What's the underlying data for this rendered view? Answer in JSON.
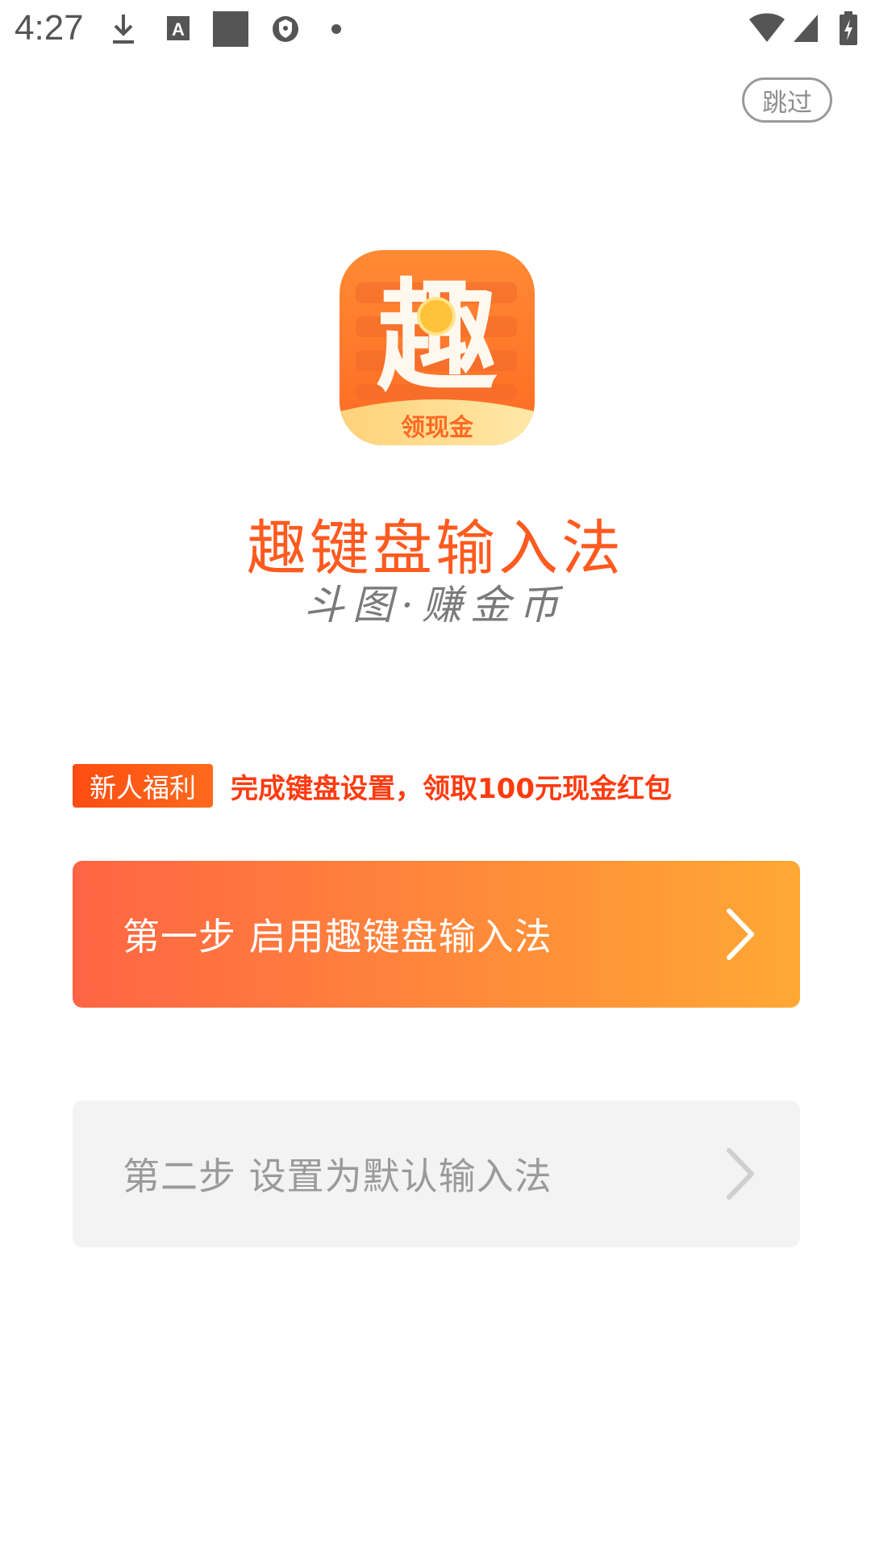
{
  "status_bar": {
    "time": "4:27",
    "icons": [
      "download-icon",
      "keyboard-a-icon",
      "square-icon",
      "shield-icon",
      "dot-icon",
      "wifi-icon",
      "signal-icon",
      "battery-charging-icon"
    ]
  },
  "skip": {
    "label": "跳过"
  },
  "logo": {
    "glyph": "趣",
    "ribbon_text": "领现金"
  },
  "app": {
    "name": "趣键盘输入法",
    "slogan": "斗图·赚金币"
  },
  "promo": {
    "badge": "新人福利",
    "text": "完成键盘设置，领取100元现金红包"
  },
  "steps": [
    {
      "label": "第一步  启用趣键盘输入法",
      "state": "active"
    },
    {
      "label": "第二步  设置为默认输入法",
      "state": "disabled"
    }
  ],
  "colors": {
    "accent": "#ff5a1f",
    "promo_red": "#ff3b10",
    "step_active_start": "#ff6544",
    "step_active_end": "#ffa834",
    "step_disabled_bg": "#f3f3f3"
  }
}
